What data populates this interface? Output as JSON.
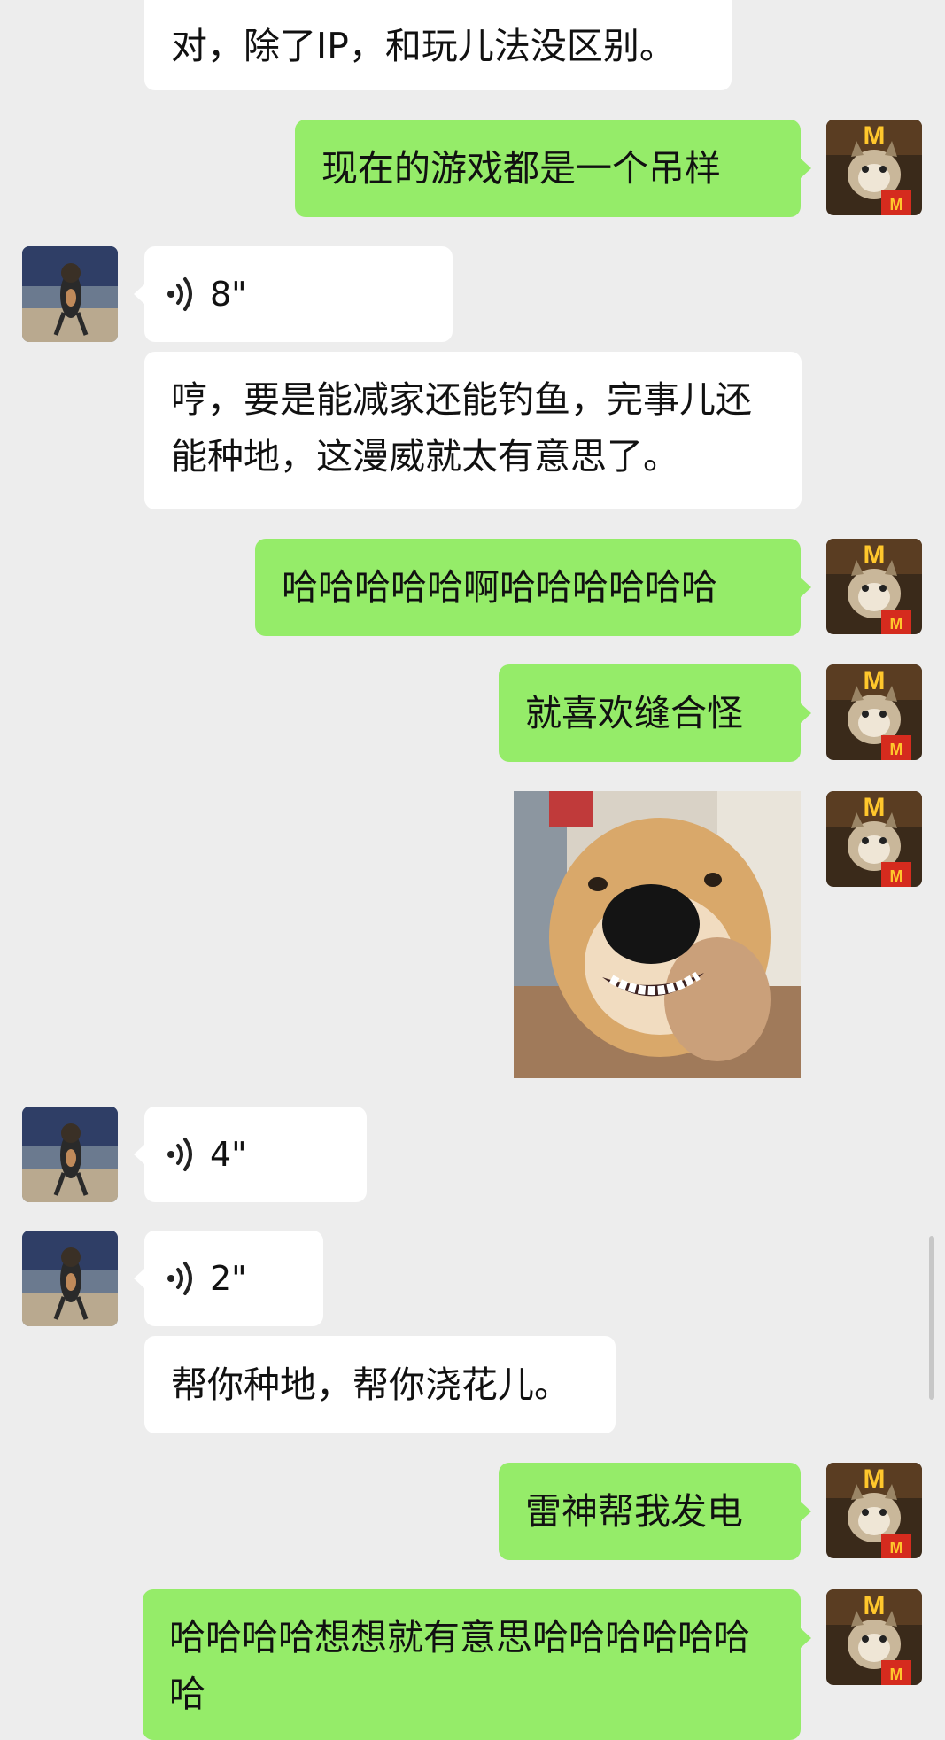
{
  "messages": [
    {
      "type": "text",
      "from": "them",
      "text": "对，除了IP，和玩儿法没区别。"
    },
    {
      "type": "text",
      "from": "me",
      "text": "现在的游戏都是一个吊样"
    },
    {
      "type": "voice",
      "from": "them",
      "duration": "8\""
    },
    {
      "type": "text",
      "from": "them",
      "text": "哼，要是能减家还能钓鱼，完事儿还能种地，这漫威就太有意思了。"
    },
    {
      "type": "text",
      "from": "me",
      "text": "哈哈哈哈哈啊哈哈哈哈哈哈"
    },
    {
      "type": "text",
      "from": "me",
      "text": "就喜欢缝合怪"
    },
    {
      "type": "image",
      "from": "me",
      "description": "smiling shiba dog"
    },
    {
      "type": "voice",
      "from": "them",
      "duration": "4\""
    },
    {
      "type": "voice",
      "from": "them",
      "duration": "2\""
    },
    {
      "type": "text",
      "from": "them",
      "text": "帮你种地，帮你浇花儿。"
    },
    {
      "type": "text",
      "from": "me",
      "text": "雷神帮我发电"
    },
    {
      "type": "text",
      "from": "me",
      "text": "哈哈哈哈想想就有意思哈哈哈哈哈哈哈"
    }
  ],
  "colors": {
    "background": "#ededed",
    "bubble_me": "#95ec69",
    "bubble_them": "#ffffff"
  },
  "icons": {
    "voice": "voice-wave-icon",
    "avatar_me": "cat-mcdonalds-avatar",
    "avatar_them": "dog-avatar"
  }
}
